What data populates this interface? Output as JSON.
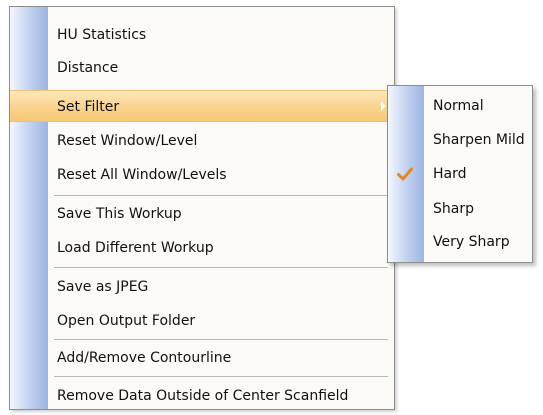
{
  "context_menu": {
    "items": [
      {
        "label": "HU Statistics"
      },
      {
        "label": "Distance"
      },
      {
        "label": "Set Filter",
        "has_submenu": true,
        "highlighted": true
      },
      {
        "label": "Reset Window/Level"
      },
      {
        "label": "Reset All Window/Levels"
      },
      {
        "label": "Save This Workup"
      },
      {
        "label": "Load Different Workup"
      },
      {
        "label": "Save as JPEG"
      },
      {
        "label": "Open Output Folder"
      },
      {
        "label": "Add/Remove Contourline"
      },
      {
        "label": "Remove Data Outside of Center Scanfield"
      }
    ]
  },
  "filter_submenu": {
    "items": [
      {
        "label": "Normal",
        "checked": false
      },
      {
        "label": "Sharpen Mild",
        "checked": false
      },
      {
        "label": "Hard",
        "checked": true
      },
      {
        "label": "Sharp",
        "checked": false
      },
      {
        "label": "Very Sharp",
        "checked": false
      }
    ]
  },
  "colors": {
    "highlight": "#f9d28b",
    "icon_strip": "#9db3e2",
    "check_mark": "#e08a1c"
  }
}
